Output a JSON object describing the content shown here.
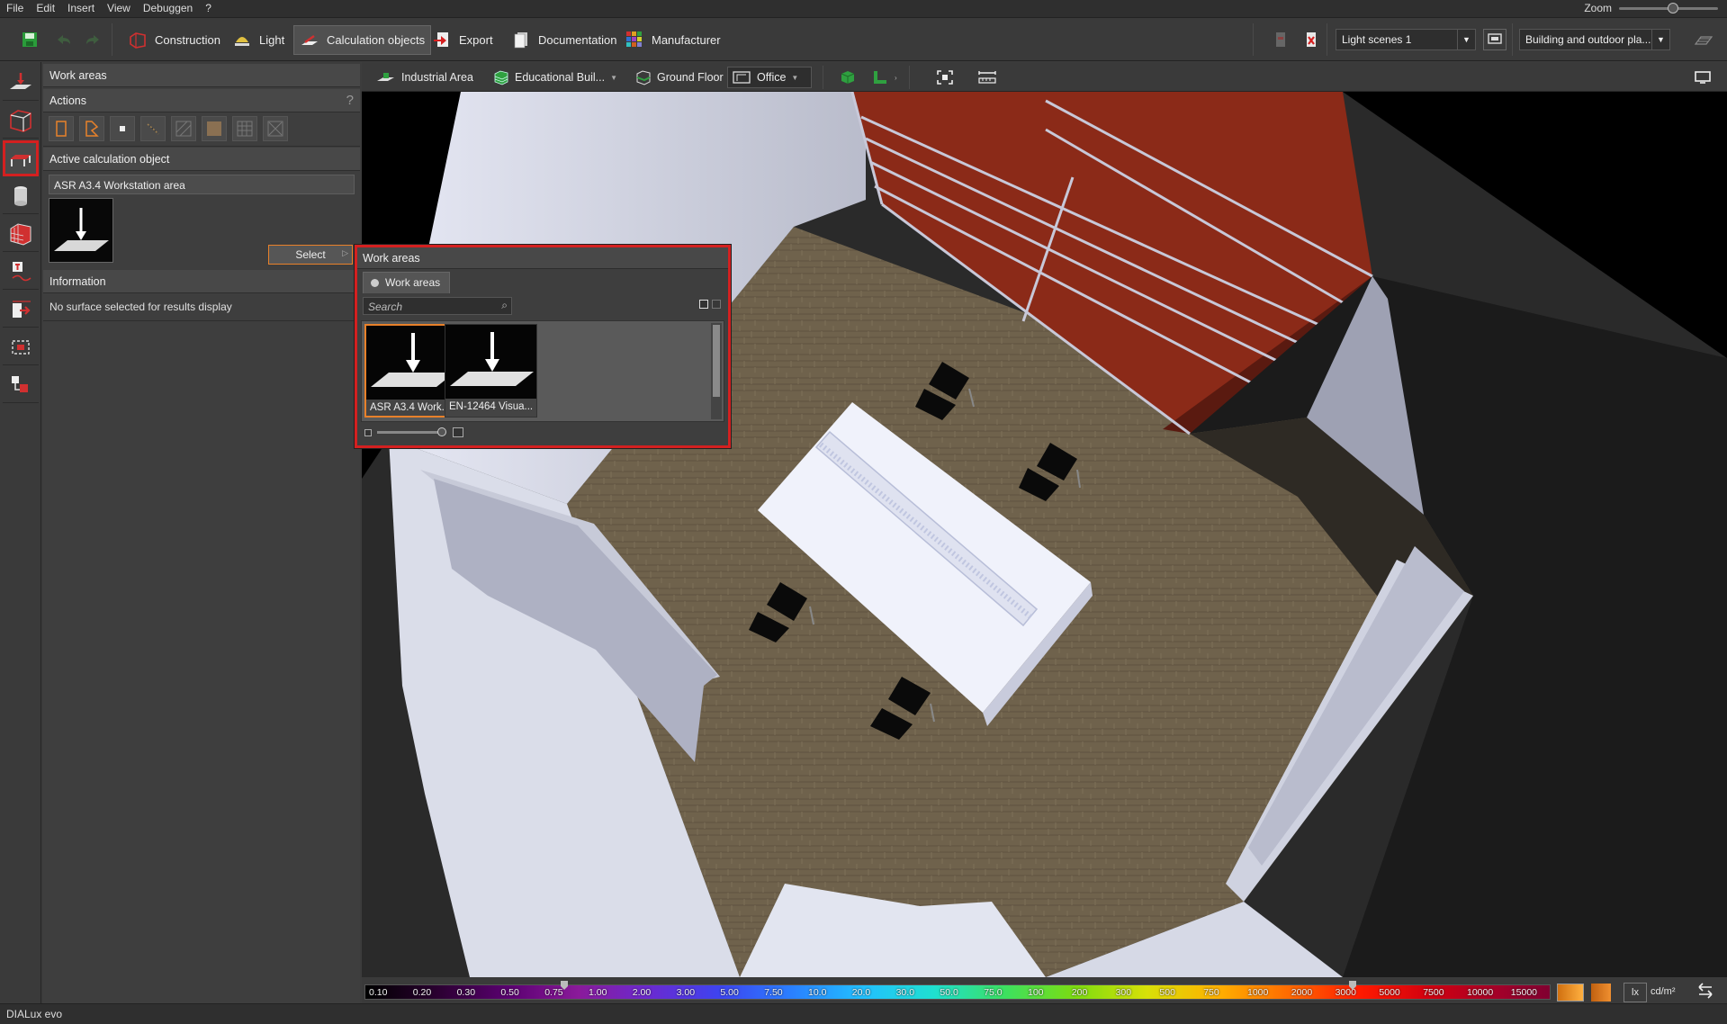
{
  "menu": [
    "File",
    "Edit",
    "Insert",
    "View",
    "Debuggen",
    "?"
  ],
  "zoom_label": "Zoom",
  "toolbar": {
    "tabs": [
      {
        "label": "Construction",
        "icon": "construction-icon"
      },
      {
        "label": "Light",
        "icon": "lamp-icon"
      },
      {
        "label": "Calculation objects",
        "icon": "calculation-icon",
        "active": true
      },
      {
        "label": "Export",
        "icon": "export-icon"
      },
      {
        "label": "Documentation",
        "icon": "documentation-icon"
      },
      {
        "label": "Manufacturer",
        "icon": "manufacturer-icon"
      }
    ],
    "light_scenes": "Light scenes 1",
    "building_select": "Building and outdoor pla..."
  },
  "panel": {
    "title": "Work areas",
    "actions_header": "Actions",
    "help": "?",
    "active_header": "Active calculation object",
    "active_value": "ASR A3.4 Workstation area",
    "select_label": "Select",
    "info_header": "Information",
    "info_text": "No surface selected for results display"
  },
  "viewbar": {
    "items": [
      "Industrial Area",
      "Educational Buil...",
      "Ground Floor",
      "Office"
    ]
  },
  "popup": {
    "title": "Work areas",
    "tab": "Work areas",
    "search_placeholder": "Search",
    "items": [
      {
        "label": "ASR A3.4 Work...",
        "selected": true
      },
      {
        "label": "EN-12464 Visua...",
        "selected": false
      }
    ]
  },
  "scale": {
    "ticks": [
      "0.10",
      "0.20",
      "0.30",
      "0.50",
      "0.75",
      "1.00",
      "2.00",
      "3.00",
      "5.00",
      "7.50",
      "10.0",
      "20.0",
      "30.0",
      "50.0",
      "75.0",
      "100",
      "200",
      "300",
      "500",
      "750",
      "1000",
      "2000",
      "3000",
      "5000",
      "7500",
      "10000",
      "15000"
    ],
    "unit_lx": "lx",
    "unit_cdm2": "cd/m²"
  },
  "status": "DIALux evo"
}
